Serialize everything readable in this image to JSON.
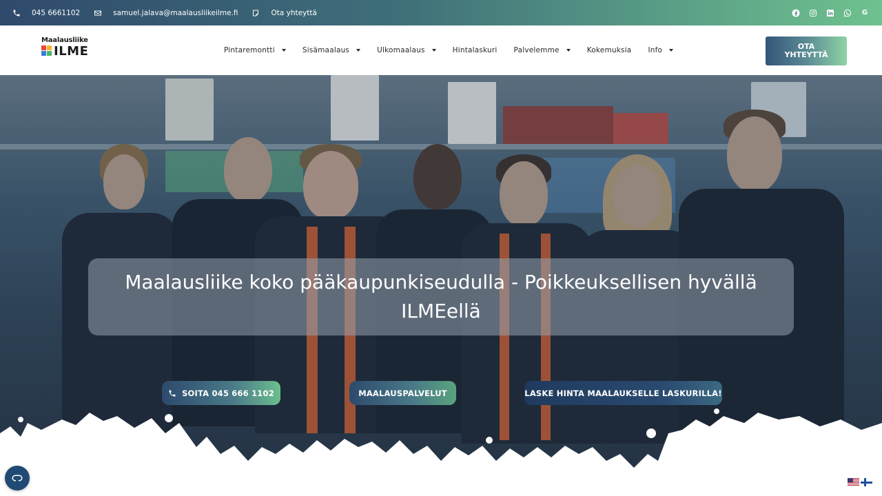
{
  "topbar": {
    "phone": "045 6661102",
    "email": "samuel.jalava@maalausliikeilme.fi",
    "contact": "Ota yhteyttä",
    "socials": [
      "facebook-icon",
      "instagram-icon",
      "linkedin-icon",
      "whatsapp-icon",
      "google-icon"
    ]
  },
  "header": {
    "logo_line1": "Maalausliike",
    "logo_line2": "ILME",
    "nav": [
      {
        "label": "Pintaremontti",
        "dropdown": true
      },
      {
        "label": "Sisämaalaus",
        "dropdown": true
      },
      {
        "label": "Ulkomaalaus",
        "dropdown": true
      },
      {
        "label": "Hintalaskuri",
        "dropdown": false
      },
      {
        "label": "Palvelemme",
        "dropdown": true
      },
      {
        "label": "Kokemuksia",
        "dropdown": false
      },
      {
        "label": "Info",
        "dropdown": true
      }
    ],
    "cta": "OTA YHTEYTTÄ"
  },
  "hero": {
    "title": "Maalausliike koko pääkaupunkiseudulla - Poikkeuksellisen hyvällä ILMEellä",
    "buttons": {
      "call": "SOITA 045 666 1102",
      "services": "MAALAUSPALVELUT",
      "calculator": "LASKE HINTA MAALAUKSELLE LASKURILLA!"
    }
  },
  "colors": {
    "brand_dark": "#2f4a6b",
    "brand_green": "#6fc28f"
  }
}
